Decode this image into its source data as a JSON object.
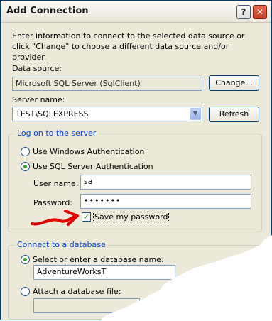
{
  "window": {
    "title": "Add Connection",
    "help_glyph": "?",
    "close_glyph": "✕"
  },
  "description": "Enter information to connect to the selected data source or click \"Change\" to choose a different data source and/or provider.",
  "data_source": {
    "label": "Data source:",
    "value": "Microsoft SQL Server (SqlClient)",
    "change_button": "Change..."
  },
  "server": {
    "label": "Server name:",
    "value": "TEST\\SQLEXPRESS",
    "refresh_button": "Refresh"
  },
  "logon_group": {
    "title": "Log on to the server",
    "windows_auth": "Use Windows Authentication",
    "sql_auth": "Use SQL Server Authentication",
    "selected": "sql_auth",
    "user_label": "User name:",
    "user_value": "sa",
    "password_label": "Password:",
    "password_value": "•••••••",
    "save_password_label": "Save my password",
    "save_password_checked": true
  },
  "database_group": {
    "title": "Connect to a database",
    "select_label": "Select or enter a database name:",
    "database_value": "AdventureWorksT",
    "attach_label": "Attach a database file:"
  },
  "colors": {
    "dialog_bg": "#ece9d8",
    "group_title": "#0046d5",
    "annotation_arrow": "#e00000"
  }
}
